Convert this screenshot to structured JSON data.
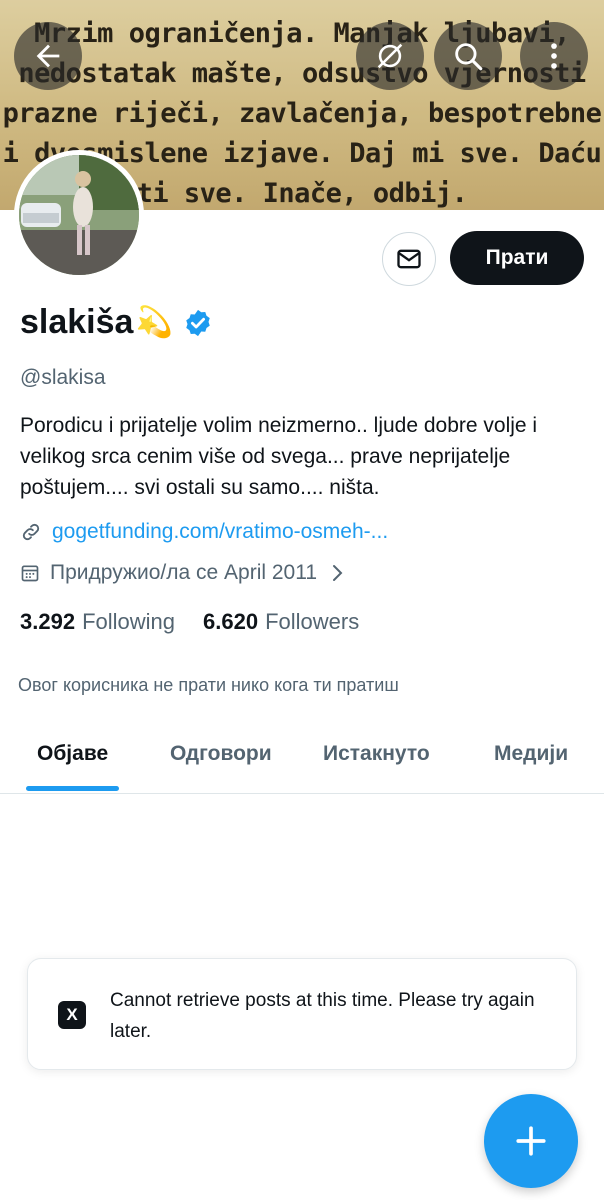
{
  "banner": {
    "lines": [
      "Mrzim ograničenja. Manjak ljubavi,",
      "nedostatak mašte, odsustvo vjernosti",
      "prazne riječi, zavlačenja, bespotrebne",
      "i dvosmislene izjave. Daj mi sve. Daću",
      "ti sve. Inače, odbij."
    ]
  },
  "topbar": {
    "back_icon": "arrow-left-icon",
    "grok_icon": "grok-icon",
    "search_icon": "search-icon",
    "more_icon": "more-vertical-icon"
  },
  "profile": {
    "display_name": "slakiša",
    "name_emoji": "💫",
    "verified_color": "#1d9bf0",
    "handle": "@slakisa",
    "bio": "Porodicu i prijatelje volim neizmerno.. ljude dobre volje i velikog srca cenim više od svega... prave neprijatelje poštujem.... svi ostali su samo.... ništa.",
    "link": "gogetfunding.com/vratimo-osmeh-...",
    "joined": "Придружио/ла се April 2011"
  },
  "actions": {
    "follow_label": "Прати",
    "message_icon": "envelope-icon"
  },
  "stats": {
    "following_count": "3.292",
    "following_label": "Following",
    "followers_count": "6.620",
    "followers_label": "Followers"
  },
  "followed_note": "Овог корисника не прати нико кога ти пратиш",
  "tabs": [
    {
      "label": "Објаве",
      "active": true
    },
    {
      "label": "Одговори",
      "active": false
    },
    {
      "label": "Истакнуто",
      "active": false
    },
    {
      "label": "Медији",
      "active": false
    }
  ],
  "toast": {
    "message": "Cannot retrieve posts at this time. Please try again later.",
    "logo": "X"
  },
  "fab": {
    "icon": "plus-icon"
  },
  "colors": {
    "accent": "#1d9bf0",
    "text": "#0f1419",
    "secondary": "#536471"
  }
}
